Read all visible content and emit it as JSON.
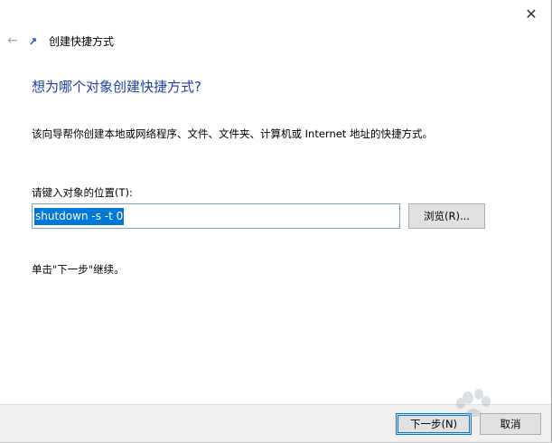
{
  "window": {
    "close_glyph": "✕",
    "title": "创建快捷方式",
    "back_glyph": "←"
  },
  "main": {
    "heading": "想为哪个对象创建快捷方式?",
    "description": "该向导帮你创建本地或网络程序、文件、文件夹、计算机或 Internet 地址的快捷方式。",
    "location_label": "请键入对象的位置(T):",
    "location_value": "shutdown -s -t 0",
    "browse_label": "浏览(R)...",
    "hint": "单击\"下一步\"继续。"
  },
  "footer": {
    "next_label": "下一步(N)",
    "cancel_label": "取消"
  },
  "colors": {
    "heading": "#1f3f9e",
    "selection": "#0078d7",
    "button_face": "#e1e1e1",
    "footer_bg": "#f0f0f0"
  },
  "icons": {
    "back": "back-arrow-icon",
    "shortcut": "shortcut-icon",
    "close": "close-icon"
  }
}
